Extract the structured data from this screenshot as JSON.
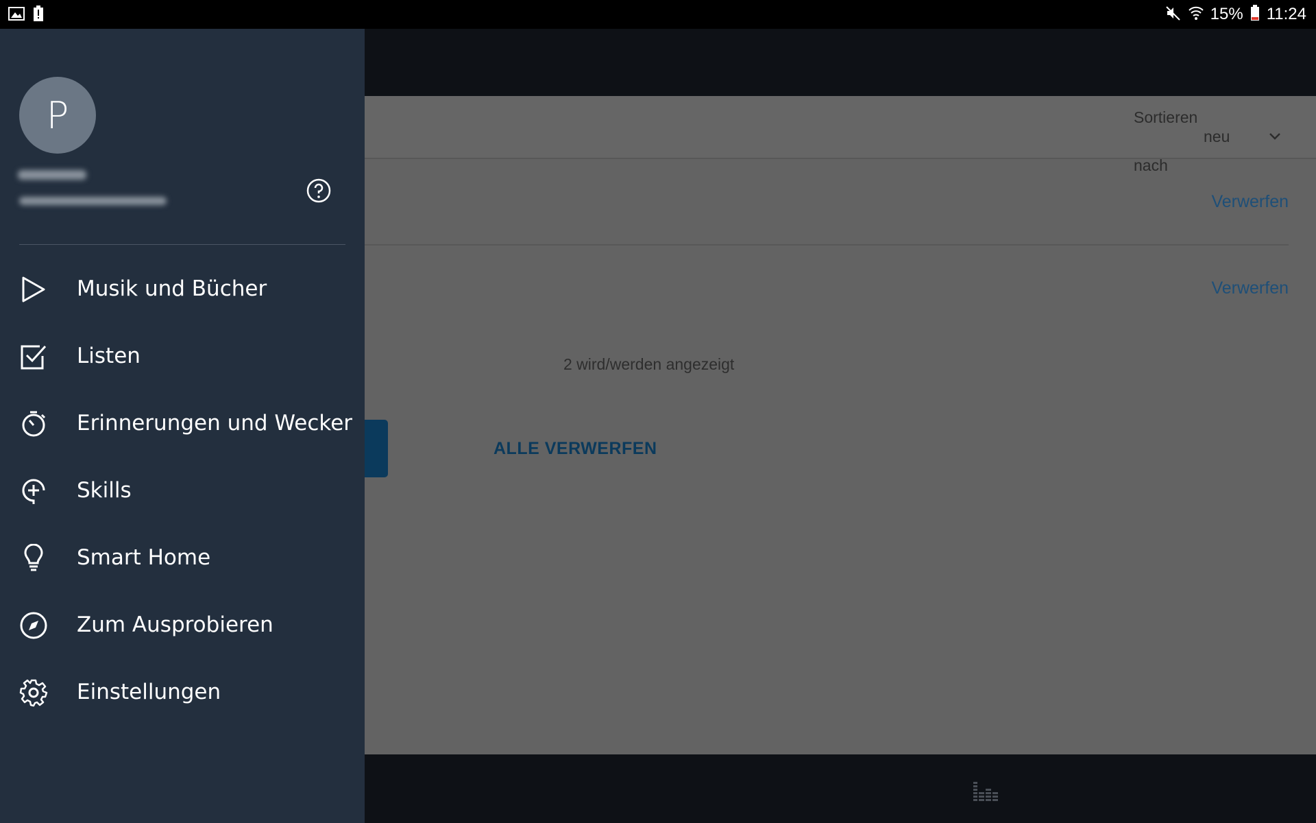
{
  "status_bar": {
    "battery_percent": "15%",
    "time": "11:24",
    "icons": [
      "gallery-icon",
      "alert-battery-icon",
      "mute-icon",
      "wifi-icon",
      "battery-icon"
    ]
  },
  "background": {
    "sort": {
      "label_line1": "Sortieren",
      "label_line2": "nach",
      "value": "neu"
    },
    "notifications": [
      {
        "dismiss_label": "Verwerfen"
      },
      {
        "dismiss_label": "Verwerfen"
      }
    ],
    "count_text": "2 wird/werden angezeigt",
    "dismiss_all_label": "ALLE VERWERFEN"
  },
  "drawer": {
    "avatar_letter": "P",
    "menu": [
      {
        "label": "Musik und Bücher",
        "icon": "play-icon"
      },
      {
        "label": "Listen",
        "icon": "checkbox-icon"
      },
      {
        "label": "Erinnerungen und Wecker",
        "icon": "timer-icon"
      },
      {
        "label": "Skills",
        "icon": "skills-icon"
      },
      {
        "label": "Smart Home",
        "icon": "lightbulb-icon"
      },
      {
        "label": "Zum Ausprobieren",
        "icon": "compass-icon"
      },
      {
        "label": "Einstellungen",
        "icon": "gear-icon"
      }
    ]
  },
  "colors": {
    "drawer_bg": "#232f3e",
    "overlay_bg": "#636363",
    "link": "#1e4f78",
    "header_bg": "#0e1116"
  }
}
